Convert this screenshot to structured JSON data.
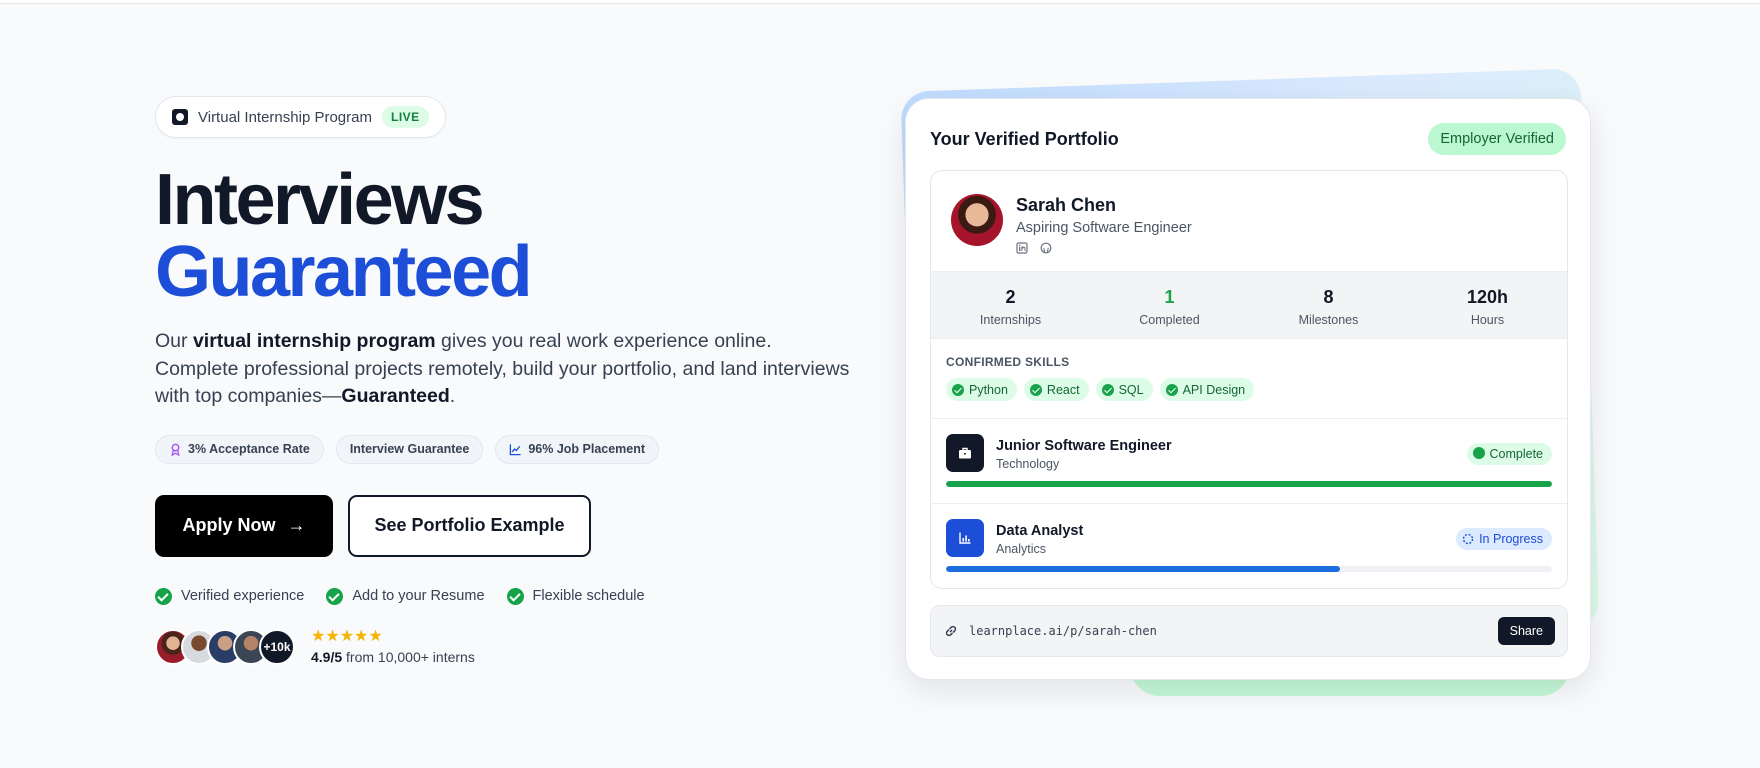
{
  "badge": {
    "text": "Virtual Internship Program",
    "live": "LIVE"
  },
  "hero": {
    "line1": "Interviews",
    "line2": "Guaranteed",
    "desc_p1": "Our ",
    "desc_b1": "virtual internship program",
    "desc_p2": " gives you real work experience online. Complete professional projects remotely, build your portfolio, and land interviews with top companies—",
    "desc_b2": "Guaranteed",
    "desc_p3": "."
  },
  "pills": [
    {
      "label": "3% Acceptance Rate",
      "icon": "award-icon"
    },
    {
      "label": "Interview Guarantee",
      "icon": ""
    },
    {
      "label": "96% Job Placement",
      "icon": "chart-line-icon"
    }
  ],
  "cta": {
    "apply": "Apply Now",
    "apply_arrow": "→",
    "portfolio": "See Portfolio Example"
  },
  "checks": [
    "Verified experience",
    "Add to your Resume",
    "Flexible schedule"
  ],
  "social": {
    "more": "+10k",
    "stars": "★★★★★",
    "score": "4.9/5",
    "from": " from 10,000+ interns"
  },
  "portfolio": {
    "title": "Your Verified Portfolio",
    "verified": "Employer Verified",
    "name": "Sarah Chen",
    "role": "Aspiring Software Engineer",
    "stats": [
      {
        "value": "2",
        "label": "Internships"
      },
      {
        "value": "1",
        "label": "Completed"
      },
      {
        "value": "8",
        "label": "Milestones"
      },
      {
        "value": "120h",
        "label": "Hours"
      }
    ],
    "skills_heading": "CONFIRMED SKILLS",
    "skills": [
      "Python",
      "React",
      "SQL",
      "API Design"
    ],
    "jobs": [
      {
        "title": "Junior Software Engineer",
        "category": "Technology",
        "status": "Complete",
        "progress": 1.0
      },
      {
        "title": "Data Analyst",
        "category": "Analytics",
        "status": "In Progress",
        "progress": 0.65
      }
    ],
    "url": "learnplace.ai/p/sarah-chen",
    "share": "Share"
  },
  "colors": {
    "accent_blue": "#1d4ed8",
    "success_green": "#16a34a",
    "dark": "#111827"
  }
}
